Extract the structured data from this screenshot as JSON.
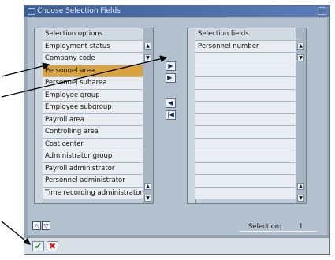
{
  "window": {
    "title": "Choose Selection Fields"
  },
  "left_list": {
    "header": "Selection options",
    "items": [
      "Employment status",
      "Company code",
      "Personnel area",
      "Personnel subarea",
      "Employee group",
      "Employee subgroup",
      "Payroll area",
      "Controlling area",
      "Cost center",
      "Administrator group",
      "Payroll administrator",
      "Personnel administrator",
      "Time recording administrator"
    ],
    "selected_item": "Personnel area"
  },
  "right_list": {
    "header": "Selection fields",
    "items": [
      "Personnel number"
    ]
  },
  "selection": {
    "label": "Selection:",
    "value": "1"
  },
  "icons": {
    "add": "arrow-right-icon",
    "add_all": "arrow-right-bar-icon",
    "remove": "arrow-left-icon",
    "remove_all": "arrow-left-bar-icon",
    "confirm": "checkmark-icon",
    "cancel": "cross-icon"
  },
  "colors": {
    "selected_row": "#d9a23c",
    "confirm": "#2a8a2a",
    "cancel": "#cc1a1a",
    "title_bar": "#3d5f98"
  }
}
